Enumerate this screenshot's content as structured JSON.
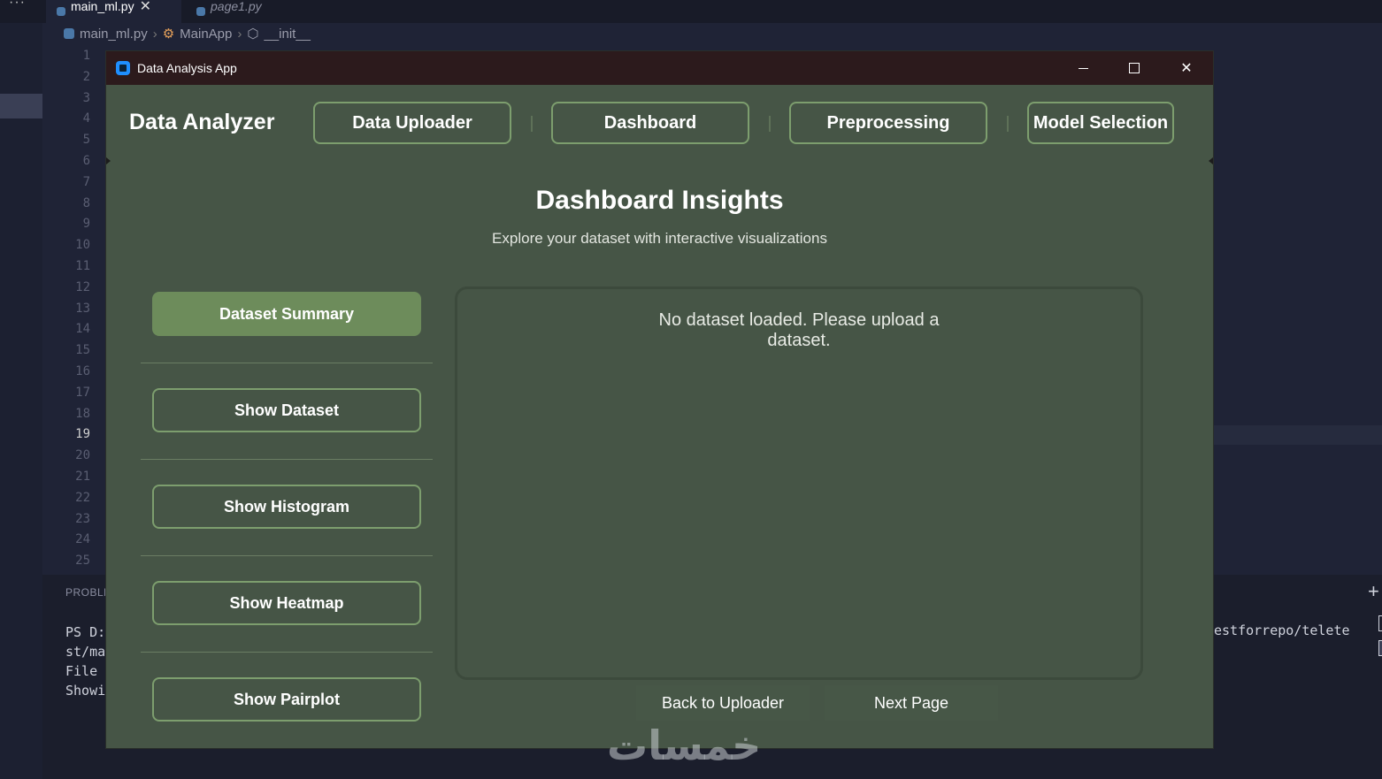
{
  "ide": {
    "more_menu": "···",
    "tabs": [
      {
        "label": "main_ml.py",
        "close": "✕"
      },
      {
        "label": "page1.py"
      }
    ],
    "breadcrumb": {
      "file": "main_ml.py",
      "class": "MainApp",
      "method": "__init__"
    },
    "line_numbers": [
      "1",
      "2",
      "3",
      "4",
      "5",
      "6",
      "7",
      "8",
      "9",
      "10",
      "11",
      "12",
      "13",
      "14",
      "15",
      "16",
      "17",
      "18",
      "19",
      "20",
      "21",
      "22",
      "23",
      "24",
      "25"
    ],
    "current_line": "19",
    "panel_title": "PROBLE",
    "terminal_lines": [
      "PS D:",
      "st/ma",
      "File",
      "Showi"
    ],
    "terminal_right": "estforrepo/telete"
  },
  "app": {
    "window_title": "Data Analysis App",
    "brand": "Data Analyzer",
    "nav": {
      "uploader": "Data Uploader",
      "dashboard": "Dashboard",
      "preprocessing": "Preprocessing",
      "model": "Model Selection"
    },
    "title": "Dashboard Insights",
    "subtitle": "Explore your dataset with interactive visualizations",
    "sidebar": {
      "summary": "Dataset Summary",
      "show_dataset": "Show Dataset",
      "histogram": "Show Histogram",
      "heatmap": "Show Heatmap",
      "pairplot": "Show Pairplot"
    },
    "content": {
      "message_line1": "No dataset loaded. Please upload a",
      "message_line2": "dataset."
    },
    "footer": {
      "back": "Back to Uploader",
      "next": "Next Page"
    }
  },
  "watermark": "خمسات",
  "colors": {
    "app_bg": "#465546",
    "accent_border": "#7d9e6e",
    "selected_button": "#6d8c5b",
    "titlebar": "#2c1a1c",
    "ide_bg": "#1f2336"
  }
}
